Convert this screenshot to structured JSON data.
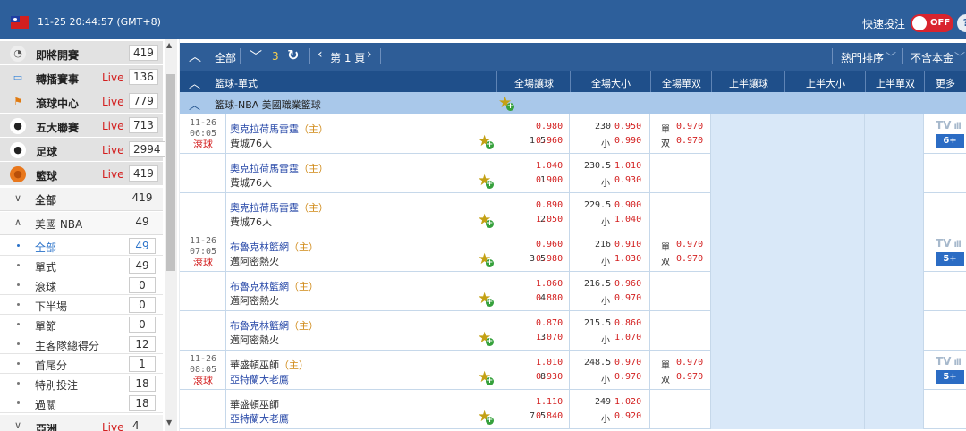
{
  "topbar": {
    "datetime": "11-25 20:44:57 (GMT+8)",
    "quick_bet_label": "快速投注",
    "toggle_state": "OFF",
    "help": "?"
  },
  "sidebar": {
    "sports": [
      {
        "name": "即將開賽",
        "live": "",
        "count": "419",
        "icon": "clock-icon"
      },
      {
        "name": "轉播賽事",
        "live": "Live",
        "count": "136",
        "icon": "tv-icon"
      },
      {
        "name": "滾球中心",
        "live": "Live",
        "count": "779",
        "icon": "running-icon"
      },
      {
        "name": "五大聯賽",
        "live": "Live",
        "count": "713",
        "icon": "soccer-ball-icon"
      },
      {
        "name": "足球",
        "live": "Live",
        "count": "2994",
        "icon": "soccer-ball-icon"
      },
      {
        "name": "籃球",
        "live": "Live",
        "count": "419",
        "icon": "basketball-icon"
      }
    ],
    "all_label": "全部",
    "all_count": "419",
    "league_label": "美國 NBA",
    "league_count": "49",
    "sub_items": [
      {
        "name": "全部",
        "count": "49",
        "active": true
      },
      {
        "name": "單式",
        "count": "49"
      },
      {
        "name": "滾球",
        "count": "0"
      },
      {
        "name": "下半場",
        "count": "0"
      },
      {
        "name": "單節",
        "count": "0"
      },
      {
        "name": "主客隊總得分",
        "count": "12"
      },
      {
        "name": "首尾分",
        "count": "1"
      },
      {
        "name": "特別投注",
        "count": "18"
      },
      {
        "name": "過關",
        "count": "18"
      }
    ],
    "next_region": {
      "name": "亞洲",
      "live": "Live",
      "count": "4"
    }
  },
  "toolbar": {
    "all_label": "全部",
    "count": "3",
    "page_label": "第 1 頁",
    "sort_label": "熱門排序",
    "principal_label": "不含本金"
  },
  "columns": {
    "bet_type": "籃球-單式",
    "full_handicap": "全場讓球",
    "full_total": "全場大小",
    "full_oddeven": "全場單双",
    "half_handicap": "上半讓球",
    "half_total": "上半大小",
    "half_oddeven": "上半單双",
    "more": "更多"
  },
  "league_row": {
    "name": "籃球-NBA 美國職業籃球"
  },
  "matches": [
    {
      "date": "11-26",
      "time": "06:05",
      "status": "滾球",
      "tv": "TV",
      "more": "6+",
      "rows": [
        {
          "home": "奧克拉荷馬雷霆",
          "host": "（主）",
          "away": "費城76人",
          "fav": "home",
          "hcp_line": "1.5",
          "hcp_home": "0.980",
          "hcp_away": "0.960",
          "ou_line": "230",
          "ou_over": "0.950",
          "ou_under_label": "小",
          "ou_under": "0.990",
          "oe_odd_label": "單",
          "oe_odd": "0.970",
          "oe_even_label": "双",
          "oe_even": "0.970"
        },
        {
          "home": "奧克拉荷馬雷霆",
          "host": "（主）",
          "away": "費城76人",
          "fav": "home",
          "hcp_line": "1",
          "hcp_home": "1.040",
          "hcp_away": "0.900",
          "ou_line": "230.5",
          "ou_over": "1.010",
          "ou_under_label": "小",
          "ou_under": "0.930"
        },
        {
          "home": "奧克拉荷馬雷霆",
          "host": "（主）",
          "away": "費城76人",
          "fav": "home",
          "hcp_line": "2",
          "hcp_home": "0.890",
          "hcp_away": "1.050",
          "ou_line": "229.5",
          "ou_over": "0.900",
          "ou_under_label": "小",
          "ou_under": "1.040"
        }
      ]
    },
    {
      "date": "11-26",
      "time": "07:05",
      "status": "滾球",
      "tv": "TV",
      "more": "5+",
      "rows": [
        {
          "home": "布魯克林籃網",
          "host": "（主）",
          "away": "邁阿密熱火",
          "fav": "home",
          "hcp_line": "3.5",
          "hcp_home": "0.960",
          "hcp_away": "0.980",
          "ou_line": "216",
          "ou_over": "0.910",
          "ou_under_label": "小",
          "ou_under": "1.030",
          "oe_odd_label": "單",
          "oe_odd": "0.970",
          "oe_even_label": "双",
          "oe_even": "0.970"
        },
        {
          "home": "布魯克林籃網",
          "host": "（主）",
          "away": "邁阿密熱火",
          "fav": "home",
          "hcp_line": "4",
          "hcp_home": "1.060",
          "hcp_away": "0.880",
          "ou_line": "216.5",
          "ou_over": "0.960",
          "ou_under_label": "小",
          "ou_under": "0.970"
        },
        {
          "home": "布魯克林籃網",
          "host": "（主）",
          "away": "邁阿密熱火",
          "fav": "home",
          "hcp_line": "3",
          "hcp_home": "0.870",
          "hcp_away": "1.070",
          "ou_line": "215.5",
          "ou_over": "0.860",
          "ou_under_label": "小",
          "ou_under": "1.070"
        }
      ]
    },
    {
      "date": "11-26",
      "time": "08:05",
      "status": "滾球",
      "tv": "TV",
      "more": "5+",
      "rows": [
        {
          "home": "華盛頓巫師",
          "host": "（主）",
          "away": "亞特蘭大老鷹",
          "fav": "away",
          "hcp_line": "8",
          "hcp_home": "1.010",
          "hcp_away": "0.930",
          "ou_line": "248.5",
          "ou_over": "0.970",
          "ou_under_label": "小",
          "ou_under": "0.970",
          "oe_odd_label": "單",
          "oe_odd": "0.970",
          "oe_even_label": "双",
          "oe_even": "0.970"
        },
        {
          "home": "華盛頓巫師",
          "host": "",
          "away": "亞特蘭大老鷹",
          "fav": "away",
          "hcp_line": "7.5",
          "hcp_home": "1.110",
          "hcp_away": "0.840",
          "ou_line": "249",
          "ou_over": "1.020",
          "ou_under_label": "小",
          "ou_under": "0.920"
        }
      ]
    }
  ]
}
